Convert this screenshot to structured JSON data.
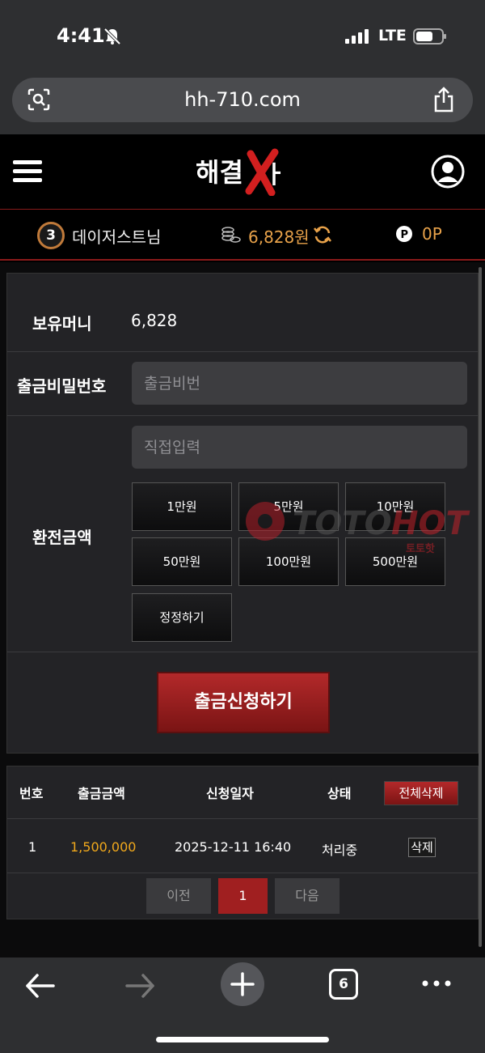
{
  "status_bar": {
    "time": "4:41",
    "network": "LTE"
  },
  "browser": {
    "url": "hh-710.com",
    "tab_count": "6"
  },
  "header": {
    "logo_text": "해결사"
  },
  "user_bar": {
    "level": "3",
    "username": "데이저스트님",
    "money": "6,828원",
    "points": "0P"
  },
  "form": {
    "balance_label": "보유머니",
    "balance_value": "6,828",
    "password_label": "출금비밀번호",
    "password_placeholder": "출금비번",
    "amount_label": "환전금액",
    "amount_placeholder": "직접입력",
    "amount_buttons": [
      "1만원",
      "5만원",
      "10만원",
      "50만원",
      "100만원",
      "500만원",
      "정정하기"
    ],
    "submit_label": "출금신청하기"
  },
  "history": {
    "headers": [
      "번호",
      "출금금액",
      "신청일자",
      "상태"
    ],
    "delete_all_label": "전체삭제",
    "rows": [
      {
        "no": "1",
        "amount": "1,500,000",
        "date": "2025-12-11 16:40",
        "status": "처리중",
        "delete_label": "삭제"
      }
    ],
    "pagination": {
      "prev": "이전",
      "current": "1",
      "next": "다음"
    }
  },
  "watermark": {
    "main": "TOTOHOT",
    "sub": "토토핫"
  },
  "colors": {
    "accent_red": "#b3292a",
    "gold": "#e8a24a",
    "amount_yellow": "#f0a81c"
  }
}
